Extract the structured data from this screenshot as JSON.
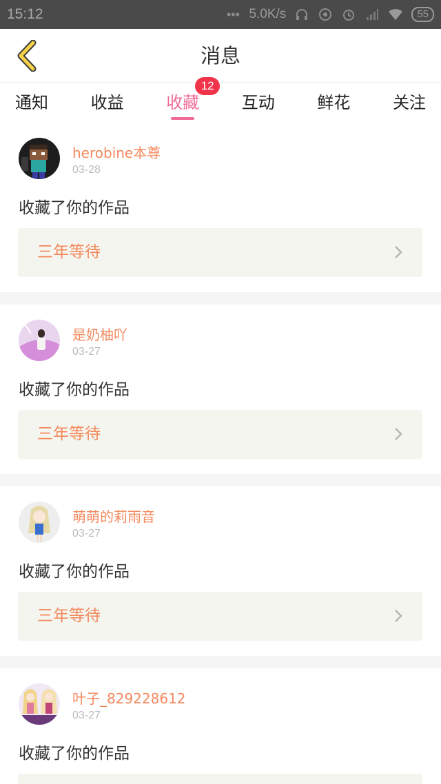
{
  "status_bar": {
    "time": "15:12",
    "network_speed": "5.0K/s",
    "battery": "55",
    "icons": [
      "dots-icon",
      "headphones-icon",
      "location-icon",
      "alarm-icon",
      "signal-icon",
      "wifi-icon",
      "battery-icon"
    ]
  },
  "header": {
    "title": "消息",
    "back_icon": "chevron-left-icon"
  },
  "tabs": [
    {
      "label": "通知",
      "active": false
    },
    {
      "label": "收益",
      "active": false
    },
    {
      "label": "收藏",
      "active": true,
      "badge": "12"
    },
    {
      "label": "互动",
      "active": false
    },
    {
      "label": "鲜花",
      "active": false
    },
    {
      "label": "关注",
      "active": false
    }
  ],
  "feed": [
    {
      "user": "herobine本尊",
      "date": "03-28",
      "action": "收藏了你的作品",
      "work_title": "三年等待",
      "avatar": "avatar-minecraft-icon"
    },
    {
      "user": "是奶柚吖",
      "date": "03-27",
      "action": "收藏了你的作品",
      "work_title": "三年等待",
      "avatar": "avatar-girl-pink-icon"
    },
    {
      "user": "萌萌的莉雨音",
      "date": "03-27",
      "action": "收藏了你的作品",
      "work_title": "三年等待",
      "avatar": "avatar-anime-girl-icon"
    },
    {
      "user": "叶子_829228612",
      "date": "03-27",
      "action": "收藏了你的作品",
      "work_title": "",
      "avatar": "avatar-two-girls-icon"
    }
  ],
  "colors": {
    "accent_pink": "#f06a9a",
    "orange_text": "#f3895d",
    "badge_red": "#f2344b",
    "back_yellow": "#f5d24a"
  }
}
